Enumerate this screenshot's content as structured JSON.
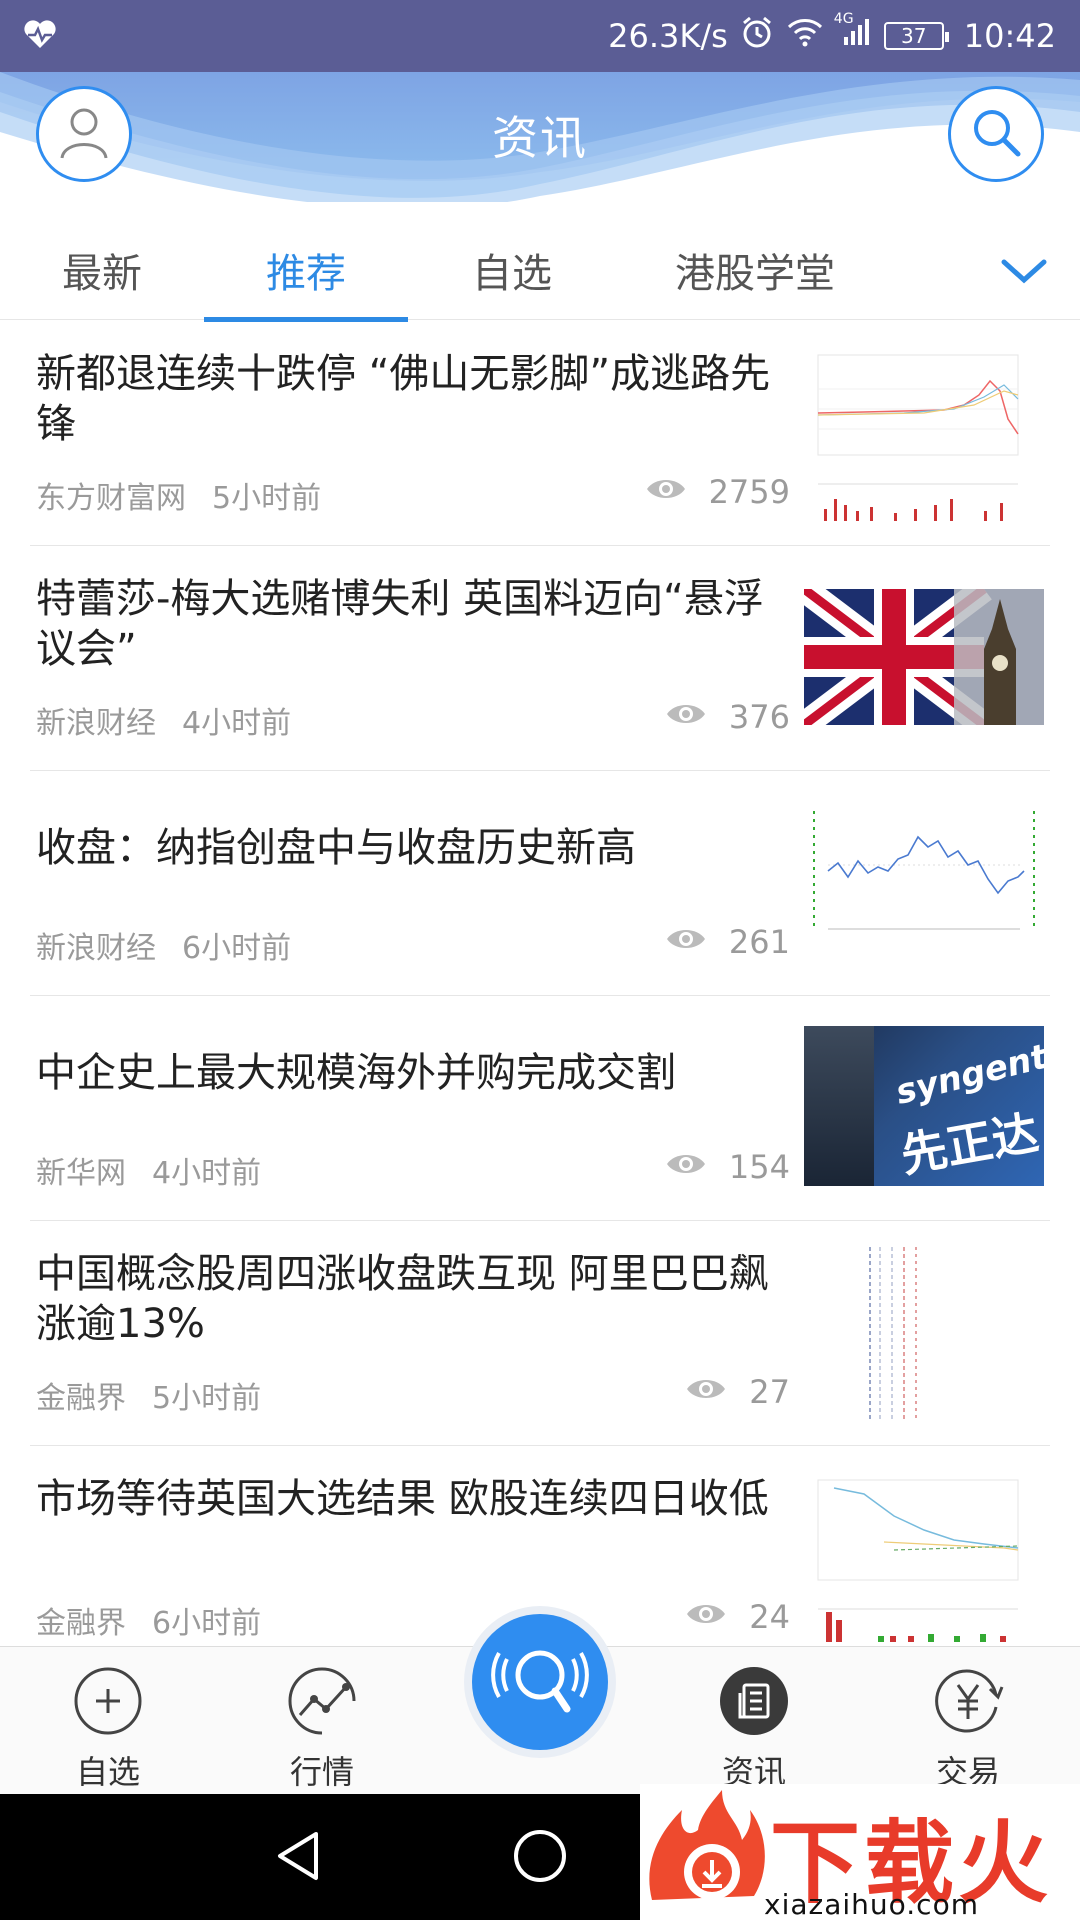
{
  "status_bar": {
    "net_speed": "26.3K/s",
    "network": "4G",
    "battery": "37",
    "time": "10:42"
  },
  "header": {
    "title": "资讯"
  },
  "tabs": [
    {
      "label": "最新",
      "active": false
    },
    {
      "label": "推荐",
      "active": true
    },
    {
      "label": "自选",
      "active": false
    },
    {
      "label": "港股学堂",
      "active": false
    }
  ],
  "news": [
    {
      "headline": "新都退连续十跌停 “佛山无影脚”成逃路先锋",
      "source": "东方财富网",
      "time": "5小时前",
      "views": "2759",
      "thumb": "stock-chart"
    },
    {
      "headline": "特蕾莎-梅大选赌博失利 英国料迈向“悬浮议会”",
      "source": "新浪财经",
      "time": "4小时前",
      "views": "376",
      "thumb": "uk-flag-big-ben"
    },
    {
      "headline": "收盘：纳指创盘中与收盘历史新高",
      "source": "新浪财经",
      "time": "6小时前",
      "views": "261",
      "thumb": "index-chart"
    },
    {
      "headline": "中企史上最大规模海外并购完成交割",
      "source": "新华网",
      "time": "4小时前",
      "views": "154",
      "thumb": "syngenta-sign"
    },
    {
      "headline": "中国概念股周四涨收盘跌互现 阿里巴巴飙涨逾13%",
      "source": "金融界",
      "time": "5小时前",
      "views": "27",
      "thumb": "stock-table"
    },
    {
      "headline": "市场等待英国大选结果 欧股连续四日收低",
      "source": "金融界",
      "time": "6小时前",
      "views": "24",
      "thumb": "stock-chart"
    }
  ],
  "thumb_text": {
    "syngenta_en": "syngenta",
    "syngenta_cn": "先正达"
  },
  "bottom_nav": [
    {
      "label": "自选",
      "icon": "plus-circle-icon"
    },
    {
      "label": "行情",
      "icon": "line-chart-icon"
    },
    {
      "label": "",
      "icon": "voice-search-icon"
    },
    {
      "label": "资讯",
      "icon": "news-icon"
    },
    {
      "label": "交易",
      "icon": "yen-icon"
    }
  ],
  "watermark": {
    "brand": "下载火",
    "url": "xiazaihuo.com"
  },
  "colors": {
    "accent": "#2d8ae4",
    "status_bar": "#5b5d95",
    "header": "#8fb4ea",
    "muted": "#9a9a9a"
  }
}
